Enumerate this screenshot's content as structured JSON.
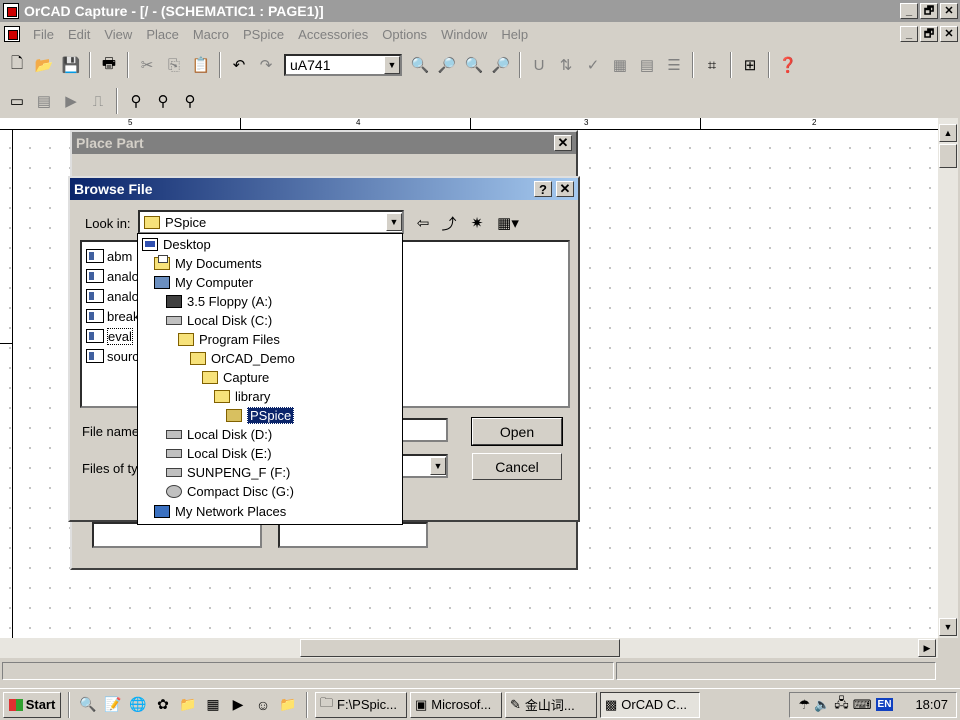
{
  "app": {
    "title": "OrCAD Capture - [/ - (SCHEMATIC1 : PAGE1)]",
    "window_buttons": [
      "_",
      "🗗",
      "✕"
    ]
  },
  "menu": [
    "File",
    "Edit",
    "View",
    "Place",
    "Macro",
    "PSpice",
    "Accessories",
    "Options",
    "Window",
    "Help"
  ],
  "toolbar": {
    "part_combo_value": "uA741"
  },
  "ruler": [
    "5",
    "4",
    "3",
    "2"
  ],
  "place_part": {
    "title": "Place Part"
  },
  "browse": {
    "title": "Browse File",
    "help": "?",
    "look_in_label": "Look in:",
    "look_in_value": "PSpice",
    "files": [
      "abm",
      "analog",
      "analog",
      "breakout",
      "eval",
      "source"
    ],
    "file_name_label": "File name:",
    "files_type_label": "Files of type:",
    "open_label": "Open",
    "cancel_label": "Cancel"
  },
  "look_in_dropdown": [
    {
      "label": "Desktop",
      "icon": "desktop-icon"
    },
    {
      "label": "My Documents",
      "icon": "my-documents-icon"
    },
    {
      "label": "My Computer",
      "icon": "my-computer-icon"
    },
    {
      "label": "3.5 Floppy (A:)",
      "icon": "floppy-icon"
    },
    {
      "label": "Local Disk (C:)",
      "icon": "drive-icon"
    },
    {
      "label": "Program Files",
      "icon": "folder-icon"
    },
    {
      "label": "OrCAD_Demo",
      "icon": "folder-icon"
    },
    {
      "label": "Capture",
      "icon": "folder-icon"
    },
    {
      "label": "library",
      "icon": "folder-icon"
    },
    {
      "label": "PSpice",
      "icon": "open-folder-icon",
      "selected": true
    },
    {
      "label": "Local Disk (D:)",
      "icon": "drive-icon"
    },
    {
      "label": "Local Disk (E:)",
      "icon": "drive-icon"
    },
    {
      "label": "SUNPENG_F (F:)",
      "icon": "drive-icon"
    },
    {
      "label": "Compact Disc (G:)",
      "icon": "cd-icon"
    },
    {
      "label": "My Network Places",
      "icon": "network-icon"
    }
  ],
  "taskbar": {
    "start": "Start",
    "tasks": [
      "F:\\PSpic...",
      "Microsof...",
      "金山词...",
      "OrCAD C..."
    ],
    "clock": "18:07",
    "lang": "EN"
  }
}
